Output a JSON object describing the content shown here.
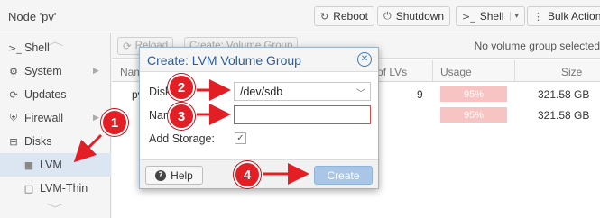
{
  "header": {
    "node_title": "Node 'pv'",
    "reboot_label": "Reboot",
    "shutdown_label": "Shutdown",
    "shell_label": "Shell",
    "bulk_label": "Bulk Actions"
  },
  "sidebar": {
    "items": [
      {
        "label": "Shell",
        "icon": "terminal-icon"
      },
      {
        "label": "System",
        "icon": "gears-icon"
      },
      {
        "label": "Updates",
        "icon": "refresh-icon"
      },
      {
        "label": "Firewall",
        "icon": "shield-icon"
      },
      {
        "label": "Disks",
        "icon": "disk-icon"
      },
      {
        "label": "LVM",
        "icon": "square-icon"
      },
      {
        "label": "LVM-Thin",
        "icon": "square-outline-icon"
      }
    ]
  },
  "main": {
    "toolbar": {
      "reload_label": "Reload",
      "create_label": "Create: Volume Group",
      "status_text": "No volume group selected"
    },
    "columns": [
      "Name",
      "Number of LVs",
      "Usage",
      "Size"
    ],
    "rows": [
      {
        "name": "pve",
        "lvs": "9",
        "usage": "95%",
        "size": "321.58 GB"
      },
      {
        "name": "",
        "lvs": "",
        "usage": "95%",
        "size": "321.58 GB"
      }
    ]
  },
  "dialog": {
    "title": "Create: LVM Volume Group",
    "disk_label": "Disk:",
    "disk_value": "/dev/sdb",
    "name_label": "Name:",
    "name_value": "",
    "add_storage_label": "Add Storage:",
    "add_storage_checked": true,
    "help_label": "Help",
    "create_label": "Create"
  },
  "annotations": {
    "badges": [
      "1",
      "2",
      "3",
      "4"
    ],
    "color": "#e41e25"
  },
  "colors": {
    "accent": "#2a5c9c",
    "invalid_border": "#e0493f",
    "usage_bar": "#f7c3c3"
  }
}
